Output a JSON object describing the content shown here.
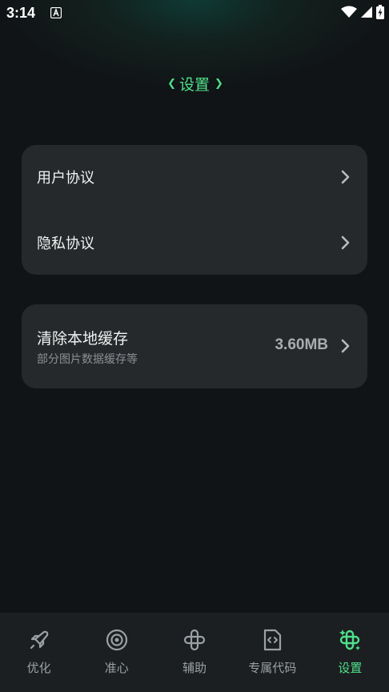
{
  "status_bar": {
    "time": "3:14"
  },
  "header": {
    "title": "设置"
  },
  "settings": {
    "group1": [
      {
        "label": "用户协议"
      },
      {
        "label": "隐私协议"
      }
    ],
    "cache": {
      "title": "清除本地缓存",
      "subtitle": "部分图片数据缓存等",
      "size": "3.60MB"
    }
  },
  "bottom_nav": {
    "items": [
      {
        "label": "优化",
        "icon": "rocket-icon",
        "active": false
      },
      {
        "label": "准心",
        "icon": "crosshair-icon",
        "active": false
      },
      {
        "label": "辅助",
        "icon": "helper-icon",
        "active": false
      },
      {
        "label": "专属代码",
        "icon": "code-file-icon",
        "active": false
      },
      {
        "label": "设置",
        "icon": "settings-icon",
        "active": true
      }
    ]
  },
  "colors": {
    "accent": "#4fe08a",
    "background": "#111416",
    "card": "#26292b",
    "nav": "#1c1f21"
  }
}
